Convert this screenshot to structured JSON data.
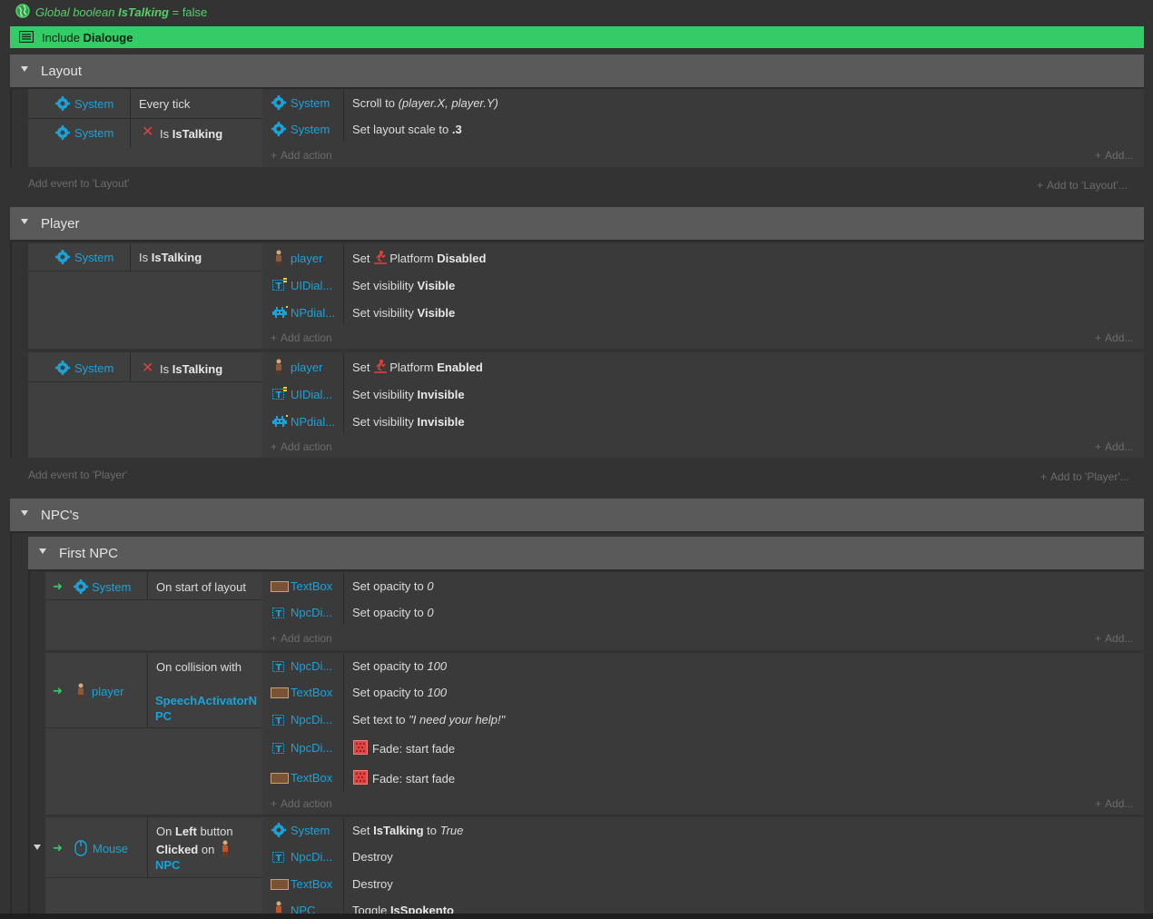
{
  "global_var": {
    "prefix": "Global boolean",
    "name": "IsTalking",
    "eq": "=",
    "value": "false"
  },
  "include": {
    "prefix": "Include",
    "name": "Dialouge"
  },
  "groups": {
    "layout": {
      "title": "Layout",
      "add_event": "Add event to 'Layout'",
      "add_to": "Add to 'Layout'..."
    },
    "player": {
      "title": "Player",
      "add_event": "Add event to 'Player'",
      "add_to": "Add to 'Player'..."
    },
    "npcs": {
      "title": "NPC's"
    },
    "first_npc": {
      "title": "First NPC"
    }
  },
  "common": {
    "system": "System",
    "add_action": "Add action",
    "add": "Add...",
    "is": "Is",
    "istalking": "IsTalking",
    "set": "Set",
    "set_opacity": "Set opacity to",
    "set_visibility": "Set visibility",
    "destroy": "Destroy",
    "fade": "Fade: start fade"
  },
  "layout_event": {
    "cond1": "Every tick",
    "act1_prefix": "Scroll to",
    "act1_args": "(player.X, player.Y)",
    "act2_prefix": "Set layout scale to",
    "act2_value": ".3"
  },
  "player_event1": {
    "act1_obj": "player",
    "act1_mid": "Platform",
    "act1_val": "Disabled",
    "act2_obj": "UIDial...",
    "act2_val": "Visible",
    "act3_obj": "NPdial...",
    "act3_val": "Visible"
  },
  "player_event2": {
    "act1_obj": "player",
    "act1_mid": "Platform",
    "act1_val": "Enabled",
    "act2_obj": "UIDial...",
    "act2_val": "Invisible",
    "act3_obj": "NPdial...",
    "act3_val": "Invisible"
  },
  "npc_event1": {
    "cond": "On start of layout",
    "act1_obj": "TextBox",
    "act1_val": "0",
    "act2_obj": "NpcDi...",
    "act2_val": "0"
  },
  "npc_event2": {
    "cond_obj": "player",
    "cond_text": "On collision with",
    "cond_target_l1": "SpeechActivatorN",
    "cond_target_l2": "PC",
    "act1_obj": "NpcDi...",
    "act1_val": "100",
    "act2_obj": "TextBox",
    "act2_val": "100",
    "act3_obj": "NpcDi...",
    "act3_prefix": "Set text to",
    "act3_val": "\"I need your help!\"",
    "act4_obj": "NpcDi...",
    "act5_obj": "TextBox"
  },
  "npc_event3": {
    "cond_obj": "Mouse",
    "cond_on": "On",
    "cond_left": "Left",
    "cond_button": "button",
    "cond_clicked": "Clicked",
    "cond_on2": "on",
    "cond_target": "NPC",
    "act1_obj": "System",
    "act1_set": "Set",
    "act1_var": "IsTalking",
    "act1_to": "to",
    "act1_val": "True",
    "act2_obj": "NpcDi...",
    "act3_obj": "TextBox",
    "act4_obj": "NPC",
    "act4_text": "Toggle",
    "act4_val": "IsSpokento"
  },
  "colors": {
    "accent": "#1aa3d9",
    "include_bar": "#33cc66",
    "header": "#5a5a5a",
    "background": "#333333"
  }
}
